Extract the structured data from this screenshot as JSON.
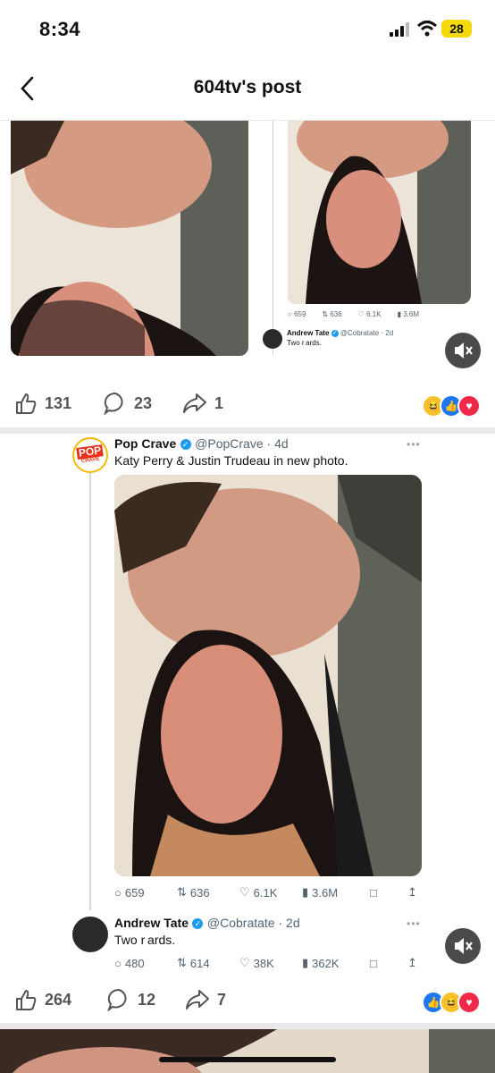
{
  "status": {
    "time": "8:34",
    "battery": "28"
  },
  "nav": {
    "title": "604tv's post"
  },
  "post1": {
    "mini_stats": [
      "659",
      "636",
      "6.1K",
      "3.6M"
    ],
    "reply_name": "Andrew Tate",
    "reply_handle": "@Cobratate · 2d",
    "reply_text": "Two r ards.",
    "reactions": {
      "likes": "131",
      "comments": "23",
      "shares": "1"
    }
  },
  "tweet": {
    "avatar_text_top": "POP",
    "avatar_text_bottom": "CRAVE",
    "name": "Pop Crave",
    "handle": "@PopCrave · 4d",
    "text": "Katy Perry & Justin Trudeau in new photo.",
    "stats": {
      "replies": "659",
      "reposts": "636",
      "likes": "6.1K",
      "views": "3.6M"
    },
    "reply": {
      "name": "Andrew Tate",
      "handle": "@Cobratate · 2d",
      "text": "Two r ards.",
      "stats": {
        "replies": "480",
        "reposts": "614",
        "likes": "38K",
        "views": "362K"
      }
    }
  },
  "post2": {
    "reactions": {
      "likes": "264",
      "comments": "12",
      "shares": "7"
    }
  },
  "colors": {
    "accent": "#1d9bf0",
    "battery": "#f5d90a",
    "band": "#e9e9e9"
  }
}
